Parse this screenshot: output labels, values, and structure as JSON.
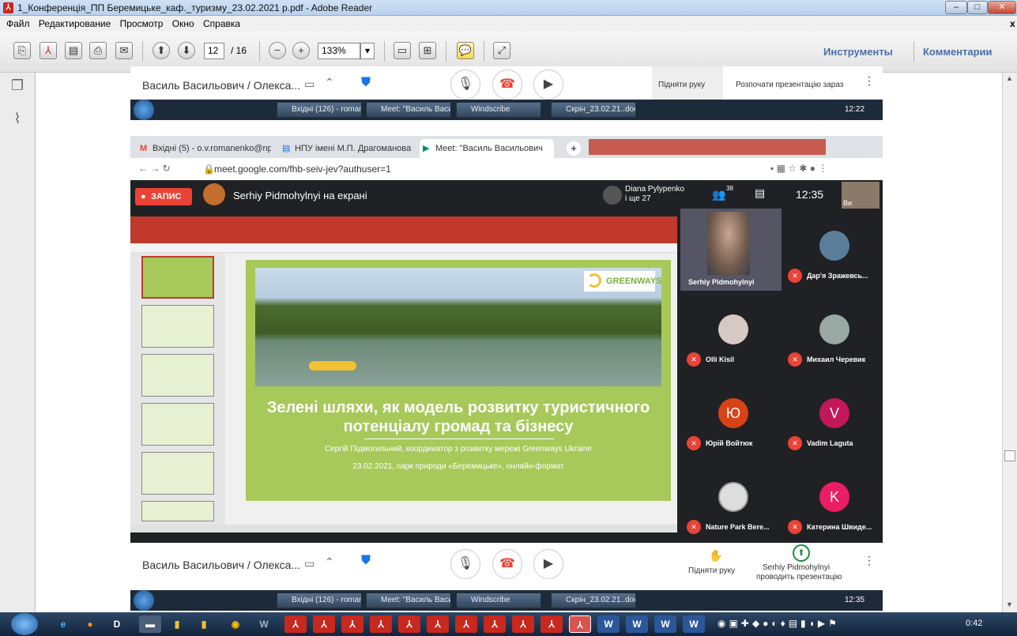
{
  "window": {
    "title": "1_Конференція_ПП Беремицьке_каф._туризму_23.02.2021 р.pdf - Adobe Reader",
    "close_x": "x"
  },
  "menu": [
    "Файл",
    "Редактирование",
    "Просмотр",
    "Окно",
    "Справка"
  ],
  "toolbar": {
    "page_current": "12",
    "page_total": "/ 16",
    "zoom": "133%",
    "tools_label": "Инструменты",
    "comments_label": "Комментарии"
  },
  "meet_top": {
    "presenter_name": "Василь Васильович / Олекса...",
    "raise_hand": "Підняти руку",
    "present_now": "Розпочати презентацію зараз"
  },
  "win_taskbar_top": {
    "items": [
      "Вхідні (126) - roman...",
      "Meet: \"Василь Васи...",
      "Windscribe",
      "Скрін_23.02.21..doc..."
    ],
    "time": "12:22"
  },
  "browser": {
    "tabs": [
      "Вхідні (5) - o.v.romanenko@npu",
      "НПУ імені М.П. Драгоманова -",
      "Meet: \"Василь Васильович"
    ],
    "url": "meet.google.com/fhb-seiv-jev?authuser=1"
  },
  "meet": {
    "record_label": "ЗАПИС",
    "screen_share": "Serhiy Pidmohylnyi на екрані",
    "participant_top": "Diana Pylypenko",
    "participant_more": "і ще 27",
    "people_count": "38",
    "time": "12:35",
    "self_label": "Ви",
    "tiles": [
      {
        "name": "Serhiy Pidmohylnyi"
      },
      {
        "name": "Дар'я Зражевсь..."
      },
      {
        "name": "Olli Kisil"
      },
      {
        "name": "Михаил Черевик"
      },
      {
        "name": "Юрій Войтюк",
        "initial": "Ю"
      },
      {
        "name": "Vadim Laguta",
        "initial": "V"
      },
      {
        "name": "Nature Park Bere..."
      },
      {
        "name": "Катерина Швиде...",
        "initial": "K"
      }
    ]
  },
  "slide": {
    "logo": "GREENWAYS",
    "title_line1": "Зелені шляхи, як модель розвитку туристичного",
    "title_line2": "потенціалу громад та бізнесу",
    "subtitle": "Сергій Підмогильний, координатор з розвитку мережі Greenways Ukraine",
    "date_line": "23.02.2021, парк природи «Беремицьке», онлайн-формат"
  },
  "meet_bottom": {
    "presenter_name": "Василь Васильович / Олекса...",
    "raise_hand": "Підняти руку",
    "presenting_name": "Serhiy Pidmohylnyi",
    "presenting_label": "проводить презентацію"
  },
  "win_taskbar_bottom": {
    "items": [
      "Вхідні (126) - roman...",
      "Meet: \"Василь Васи...",
      "Windscribe",
      "Скрін_23.02.21..doc..."
    ],
    "time": "12:35"
  },
  "os_taskbar": {
    "time": "0:42"
  },
  "colors": {
    "slide_green": "#a6c95a",
    "record_red": "#ea4335",
    "meet_dark": "#202124"
  }
}
